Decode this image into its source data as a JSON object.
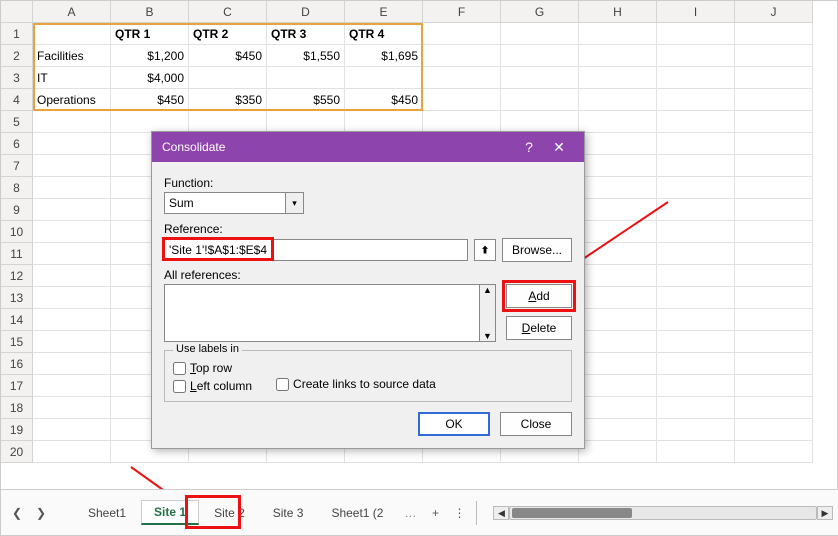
{
  "columns": [
    "A",
    "B",
    "C",
    "D",
    "E",
    "F",
    "G",
    "H",
    "I",
    "J"
  ],
  "rows_count": 20,
  "headers": [
    "",
    "QTR 1",
    "QTR 2",
    "QTR 3",
    "QTR 4"
  ],
  "data_rows": [
    {
      "label": "Facilities",
      "vals": [
        "$1,200",
        "$450",
        "$1,550",
        "$1,695"
      ]
    },
    {
      "label": "IT",
      "vals": [
        "$4,000",
        "",
        "",
        ""
      ]
    },
    {
      "label": "Operations",
      "vals": [
        "$450",
        "$350",
        "$550",
        "$450"
      ]
    }
  ],
  "dialog": {
    "title": "Consolidate",
    "function_label": "Function:",
    "function_value": "Sum",
    "reference_label": "Reference:",
    "reference_value": "'Site 1'!$A$1:$E$4",
    "browse": "Browse...",
    "all_refs_label": "All references:",
    "add": "Add",
    "delete": "Delete",
    "use_labels": "Use labels in",
    "top_row": "Top row",
    "left_column": "Left column",
    "create_links": "Create links to source data",
    "ok": "OK",
    "close": "Close"
  },
  "tabs": {
    "sheets": [
      "Sheet1",
      "Site 1",
      "Site 2",
      "Site 3",
      "Sheet1 (2"
    ],
    "active_index": 1
  }
}
